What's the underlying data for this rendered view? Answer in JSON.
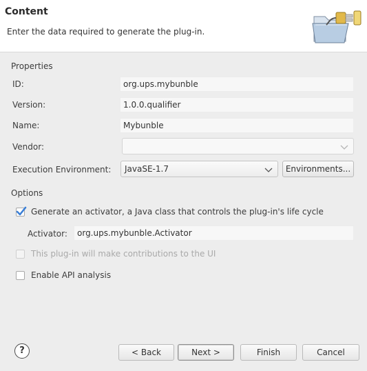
{
  "header": {
    "title": "Content",
    "description": "Enter the data required to generate the plug-in."
  },
  "properties": {
    "group_label": "Properties",
    "id_label": "ID:",
    "id_value": "org.ups.mybunble",
    "version_label": "Version:",
    "version_value": "1.0.0.qualifier",
    "name_label": "Name:",
    "name_value": "Mybunble",
    "vendor_label": "Vendor:",
    "vendor_value": "",
    "exec_env_label": "Execution Environment:",
    "exec_env_value": "JavaSE-1.7",
    "environments_button": "Environments..."
  },
  "options": {
    "group_label": "Options",
    "generate_activator_label": "Generate an activator, a Java class that controls the plug-in's life cycle",
    "generate_activator_checked": true,
    "activator_label": "Activator:",
    "activator_value": "org.ups.mybunble.Activator",
    "ui_contrib_label": "This plug-in will make contributions to the UI",
    "ui_contrib_checked": false,
    "ui_contrib_enabled": false,
    "api_analysis_label": "Enable API analysis",
    "api_analysis_checked": false
  },
  "footer": {
    "help_symbol": "?",
    "back_label": "< Back",
    "next_label": "Next >",
    "finish_label": "Finish",
    "cancel_label": "Cancel"
  },
  "colors": {
    "check_accent": "#3b7fd6",
    "header_bg": "#ffffff",
    "dialog_bg": "#ededed"
  },
  "icons": {
    "banner": "plugin-folder-icon",
    "help": "help-icon",
    "dropdown": "chevron-down-icon",
    "check": "checkmark-icon"
  }
}
